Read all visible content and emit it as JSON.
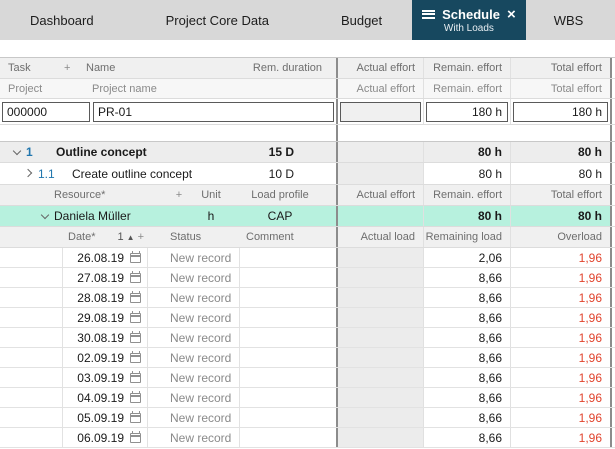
{
  "colors": {
    "active_tab_bg": "#17485f",
    "highlight_row_bg": "#b7f1de",
    "overload_text": "#e0432d",
    "task_number_blue": "#2176ae"
  },
  "tabs": {
    "dashboard": "Dashboard",
    "project_core_data": "Project Core Data",
    "budget": "Budget",
    "schedule": "Schedule",
    "schedule_sub": "With Loads",
    "close_icon": "×",
    "wbs": "WBS"
  },
  "task_header": {
    "task": "Task",
    "add": "+",
    "name": "Name",
    "rem_duration": "Rem. duration"
  },
  "effort_header": {
    "actual": "Actual effort",
    "remain": "Remain. effort",
    "total": "Total effort"
  },
  "project_header": {
    "project": "Project",
    "project_name": "Project name"
  },
  "project_row": {
    "id": "000000",
    "name": "PR-01",
    "actual": "",
    "remain": "180 h",
    "total": "180 h"
  },
  "tasks": {
    "t1": {
      "num": "1",
      "name": "Outline concept",
      "dur": "15 D",
      "remain": "80 h",
      "total": "80 h"
    },
    "t11": {
      "num": "1.1",
      "name": "Create outline concept",
      "dur": "10 D",
      "remain": "80 h",
      "total": "80 h"
    }
  },
  "resource_header": {
    "resource": "Resource*",
    "add": "+",
    "unit": "Unit",
    "profile": "Load profile"
  },
  "resource_row": {
    "name": "Daniela Müller",
    "unit": "h",
    "profile": "CAP",
    "remain": "80 h",
    "total": "80 h"
  },
  "load_header": {
    "date": "Date*",
    "sort_num": "1",
    "sort_arrow": "▲",
    "add": "+",
    "status": "Status",
    "comment": "Comment",
    "actual": "Actual load",
    "remaining": "Remaining load",
    "overload": "Overload"
  },
  "date_rows": [
    {
      "date": "26.08.19",
      "status": "New record",
      "comment": "",
      "actual_load": "",
      "remaining_load": "2,06",
      "overload": "1,96"
    },
    {
      "date": "27.08.19",
      "status": "New record",
      "comment": "",
      "actual_load": "",
      "remaining_load": "8,66",
      "overload": "1,96"
    },
    {
      "date": "28.08.19",
      "status": "New record",
      "comment": "",
      "actual_load": "",
      "remaining_load": "8,66",
      "overload": "1,96"
    },
    {
      "date": "29.08.19",
      "status": "New record",
      "comment": "",
      "actual_load": "",
      "remaining_load": "8,66",
      "overload": "1,96"
    },
    {
      "date": "30.08.19",
      "status": "New record",
      "comment": "",
      "actual_load": "",
      "remaining_load": "8,66",
      "overload": "1,96"
    },
    {
      "date": "02.09.19",
      "status": "New record",
      "comment": "",
      "actual_load": "",
      "remaining_load": "8,66",
      "overload": "1,96"
    },
    {
      "date": "03.09.19",
      "status": "New record",
      "comment": "",
      "actual_load": "",
      "remaining_load": "8,66",
      "overload": "1,96"
    },
    {
      "date": "04.09.19",
      "status": "New record",
      "comment": "",
      "actual_load": "",
      "remaining_load": "8,66",
      "overload": "1,96"
    },
    {
      "date": "05.09.19",
      "status": "New record",
      "comment": "",
      "actual_load": "",
      "remaining_load": "8,66",
      "overload": "1,96"
    },
    {
      "date": "06.09.19",
      "status": "New record",
      "comment": "",
      "actual_load": "",
      "remaining_load": "8,66",
      "overload": "1,96"
    }
  ]
}
